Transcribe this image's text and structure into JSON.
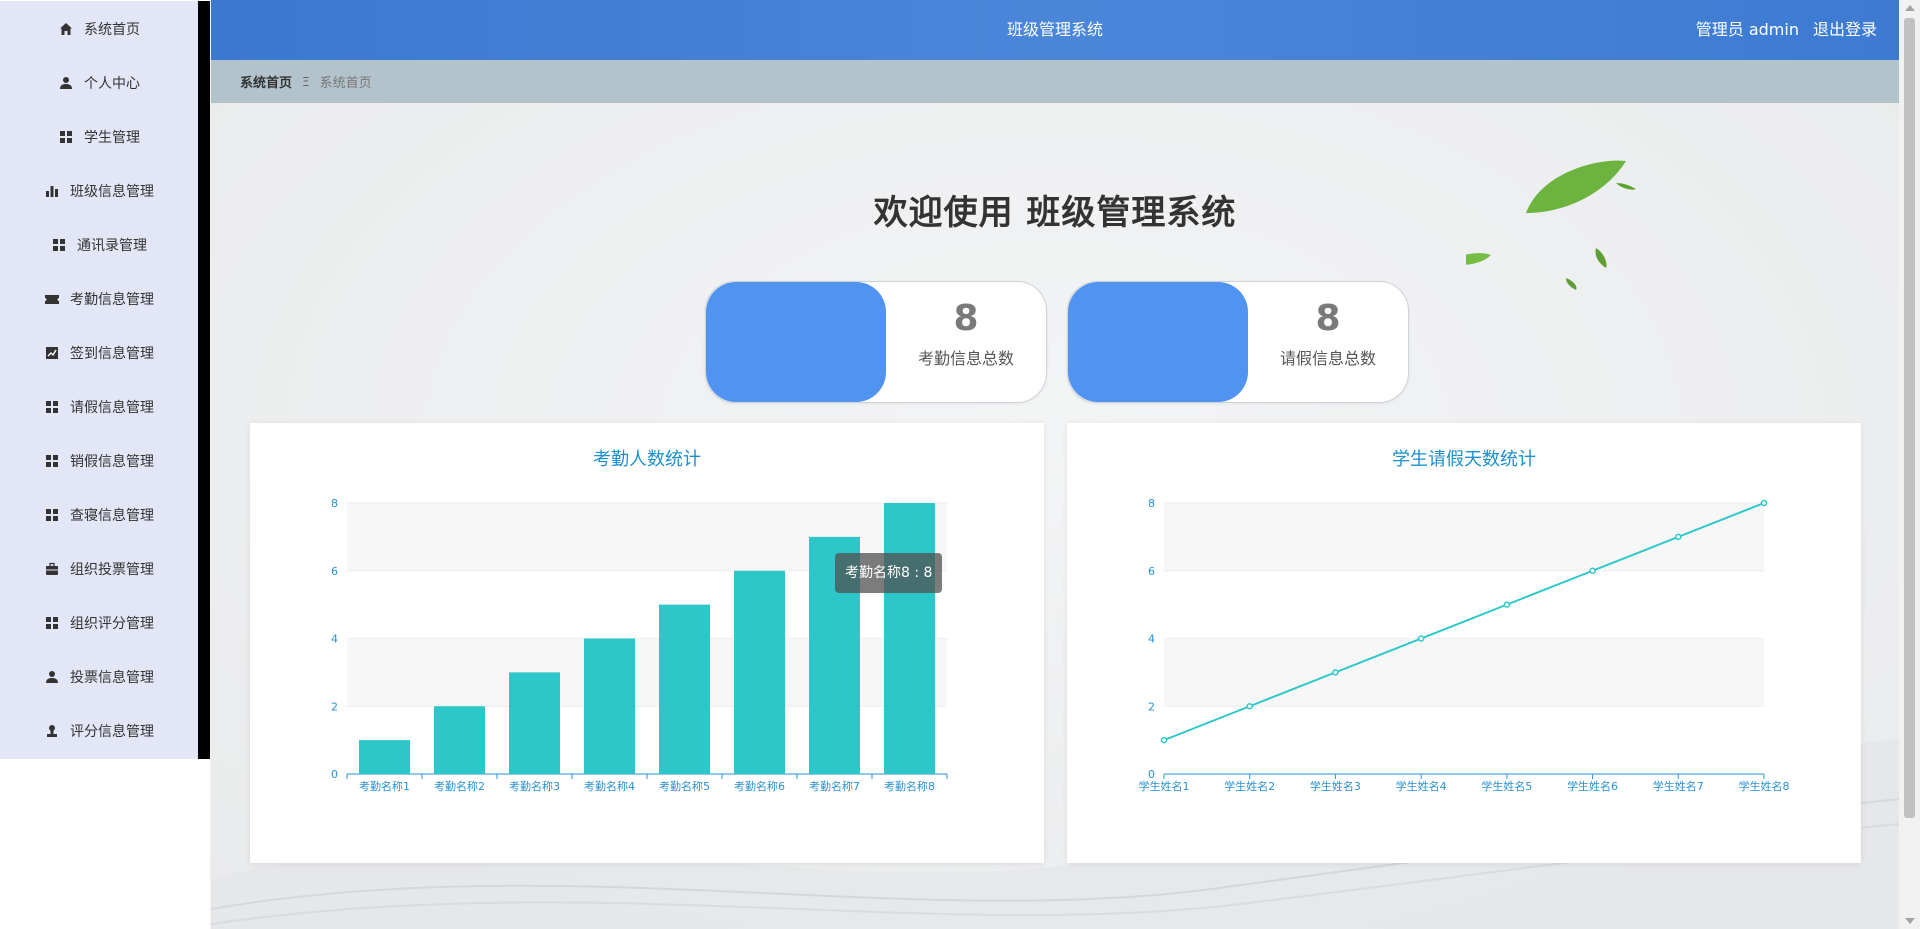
{
  "app": {
    "title": "班级管理系统"
  },
  "header": {
    "user_label": "管理员 admin",
    "logout_label": "退出登录"
  },
  "breadcrumb": {
    "home": "系统首页",
    "separator": "Ξ",
    "current": "系统首页"
  },
  "sidebar": {
    "items": [
      {
        "label": "系统首页",
        "icon": "home-icon"
      },
      {
        "label": "个人中心",
        "icon": "user-icon"
      },
      {
        "label": "学生管理",
        "icon": "grid-icon"
      },
      {
        "label": "班级信息管理",
        "icon": "bar-chart-icon"
      },
      {
        "label": "通讯录管理",
        "icon": "grid-icon"
      },
      {
        "label": "考勤信息管理",
        "icon": "ticket-icon"
      },
      {
        "label": "签到信息管理",
        "icon": "line-chart-icon"
      },
      {
        "label": "请假信息管理",
        "icon": "grid-icon"
      },
      {
        "label": "销假信息管理",
        "icon": "grid-icon"
      },
      {
        "label": "查寝信息管理",
        "icon": "grid-icon"
      },
      {
        "label": "组织投票管理",
        "icon": "briefcase-icon"
      },
      {
        "label": "组织评分管理",
        "icon": "grid-icon"
      },
      {
        "label": "投票信息管理",
        "icon": "user-icon"
      },
      {
        "label": "评分信息管理",
        "icon": "stamp-icon"
      }
    ]
  },
  "welcome": {
    "text": "欢迎使用 班级管理系统"
  },
  "stats": [
    {
      "value": "8",
      "caption": "考勤信息总数"
    },
    {
      "value": "8",
      "caption": "请假信息总数"
    }
  ],
  "colors": {
    "header": "#3f7fd6",
    "card_blue": "#5093f0",
    "series": "#2ec7c9",
    "axis": "#2a91cf"
  },
  "tooltip": {
    "text": "考勤名称8 : 8"
  },
  "chart_data": [
    {
      "type": "bar",
      "title": "考勤人数统计",
      "categories": [
        "考勤名称1",
        "考勤名称2",
        "考勤名称3",
        "考勤名称4",
        "考勤名称5",
        "考勤名称6",
        "考勤名称7",
        "考勤名称8"
      ],
      "values": [
        1,
        2,
        3,
        4,
        5,
        6,
        7,
        8
      ],
      "ylim": [
        0,
        8
      ],
      "yticks": [
        0,
        2,
        4,
        6,
        8
      ],
      "grid": true
    },
    {
      "type": "line",
      "title": "学生请假天数统计",
      "categories": [
        "学生姓名1",
        "学生姓名2",
        "学生姓名3",
        "学生姓名4",
        "学生姓名5",
        "学生姓名6",
        "学生姓名7",
        "学生姓名8"
      ],
      "values": [
        1,
        2,
        3,
        4,
        5,
        6,
        7,
        8
      ],
      "ylim": [
        0,
        8
      ],
      "yticks": [
        0,
        2,
        4,
        6,
        8
      ],
      "grid": true
    }
  ]
}
